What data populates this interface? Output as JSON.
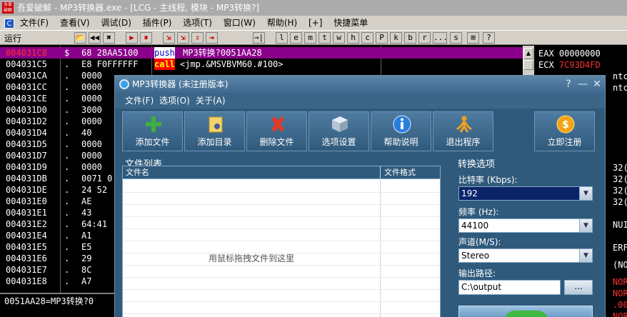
{
  "olly": {
    "title": "吾爱破解 - MP3转换器.exe - [LCG - 主线程, 模块 - MP3转换?]",
    "logo_text": "吾爱破解",
    "menu": [
      "文件(F)",
      "查看(V)",
      "调试(D)",
      "插件(P)",
      "选项(T)",
      "窗口(W)",
      "帮助(H)",
      "[+]",
      "快捷菜单"
    ],
    "menu_icon": "C",
    "run_label": "运行",
    "toolbar_buttons": [
      "📂",
      "◀◀",
      "✖",
      "▶",
      "⏸",
      "⇲",
      "⇲",
      "⇳",
      "⇥",
      "→|",
      "l",
      "e",
      "m",
      "t",
      "w",
      "h",
      "c",
      "P",
      "k",
      "b",
      "r",
      "...",
      "s",
      "⊞",
      "?"
    ],
    "rows": [
      {
        "addr": "004031C8",
        "mark": "$",
        "hex": "68 28AA5100",
        "op": "push",
        "arg": "MP3转换?0051AA28"
      },
      {
        "addr": "004031C5",
        "mark": ".",
        "hex": "E8 F0FFFFFF",
        "op": "call",
        "arg": "<jmp.&MSVBVM60.#100>"
      },
      {
        "addr": "004031CA",
        "mark": ".",
        "hex": "0000",
        "op": "",
        "arg": ""
      },
      {
        "addr": "004031CC",
        "mark": ".",
        "hex": "0000",
        "op": "",
        "arg": ""
      },
      {
        "addr": "004031CE",
        "mark": ".",
        "hex": "0000",
        "op": "",
        "arg": ""
      },
      {
        "addr": "004031D0",
        "mark": ".",
        "hex": "3000",
        "op": "",
        "arg": ""
      },
      {
        "addr": "004031D2",
        "mark": ".",
        "hex": "0000",
        "op": "",
        "arg": ""
      },
      {
        "addr": "004031D4",
        "mark": ".",
        "hex": "40",
        "op": "",
        "arg": ""
      },
      {
        "addr": "004031D5",
        "mark": ".",
        "hex": "0000",
        "op": "",
        "arg": ""
      },
      {
        "addr": "004031D7",
        "mark": ".",
        "hex": "0000",
        "op": "",
        "arg": ""
      },
      {
        "addr": "004031D9",
        "mark": ".",
        "hex": "0000",
        "op": "",
        "arg": ""
      },
      {
        "addr": "004031DB",
        "mark": ".",
        "hex": "0071 0",
        "op": "",
        "arg": ""
      },
      {
        "addr": "004031DE",
        "mark": ".",
        "hex": "24 52",
        "op": "",
        "arg": ""
      },
      {
        "addr": "004031E0",
        "mark": ".",
        "hex": "AE",
        "op": "",
        "arg": ""
      },
      {
        "addr": "004031E1",
        "mark": ".",
        "hex": "43",
        "op": "",
        "arg": ""
      },
      {
        "addr": "004031E2",
        "mark": ".",
        "hex": "64:41",
        "op": "",
        "arg": ""
      },
      {
        "addr": "004031E4",
        "mark": ".",
        "hex": "A1",
        "op": "",
        "arg": ""
      },
      {
        "addr": "004031E5",
        "mark": ".",
        "hex": "E5",
        "op": "",
        "arg": ""
      },
      {
        "addr": "004031E6",
        "mark": ".",
        "hex": "29",
        "op": "",
        "arg": ""
      },
      {
        "addr": "004031E7",
        "mark": ".",
        "hex": "8C",
        "op": "",
        "arg": ""
      },
      {
        "addr": "004031E8",
        "mark": ".",
        "hex": "A7",
        "op": "",
        "arg": ""
      }
    ],
    "registers": [
      {
        "name": "EAX",
        "value": "00000000",
        "color": "#ffffff"
      },
      {
        "name": "ECX",
        "value": "7C93D4FD",
        "color": "#ff3030"
      },
      {
        "name": "",
        "value": "ntc",
        "color": "#ffffff"
      },
      {
        "name": "",
        "value": "ntc",
        "color": "#ffffff"
      },
      {
        "name": "",
        "value": "32(",
        "color": "#ffffff"
      },
      {
        "name": "",
        "value": "32(",
        "color": "#ffffff"
      },
      {
        "name": "",
        "value": "32(",
        "color": "#ffffff"
      },
      {
        "name": "",
        "value": "32(",
        "color": "#ffffff"
      },
      {
        "name": "",
        "value": "NUI",
        "color": "#ffffff"
      },
      {
        "name": "",
        "value": "ERF",
        "color": "#ffffff"
      },
      {
        "name": "",
        "value": "(NO",
        "color": "#ffffff"
      },
      {
        "name": "",
        "value": "NORM",
        "color": "#ff3030"
      },
      {
        "name": "",
        "value": "NORM",
        "color": "#ff3030"
      },
      {
        "name": "",
        "value": ".002",
        "color": "#ff3030"
      },
      {
        "name": "",
        "value": "NORM",
        "color": "#ff3030"
      }
    ],
    "status_text": "0051AA28=MP3转换?0"
  },
  "dialog": {
    "title": "MP3转换器 (未注册版本)",
    "menu": [
      "文件(F)",
      "选项(O)",
      "关于(A)"
    ],
    "tools": [
      {
        "label": "添加文件",
        "icon": "add-file-icon"
      },
      {
        "label": "添加目录",
        "icon": "add-folder-icon"
      },
      {
        "label": "删除文件",
        "icon": "delete-icon"
      },
      {
        "label": "选项设置",
        "icon": "settings-cube-icon"
      },
      {
        "label": "帮助说明",
        "icon": "info-icon"
      },
      {
        "label": "退出程序",
        "icon": "exit-icon"
      },
      {
        "label": "立即注册",
        "icon": "register-coin-icon"
      }
    ],
    "file_list": {
      "title": "文件列表",
      "col_name": "文件名",
      "col_format": "文件格式",
      "drop_hint": "用鼠标拖拽文件到这里"
    },
    "options": {
      "title": "转换选项",
      "bitrate_label": "比特率 (Kbps):",
      "bitrate_value": "192",
      "freq_label": "频率 (Hz):",
      "freq_value": "44100",
      "channel_label": "声道(M/S):",
      "channel_value": "Stereo",
      "output_label": "输出路径:",
      "output_value": "C:\\output",
      "browse_label": "..."
    }
  }
}
